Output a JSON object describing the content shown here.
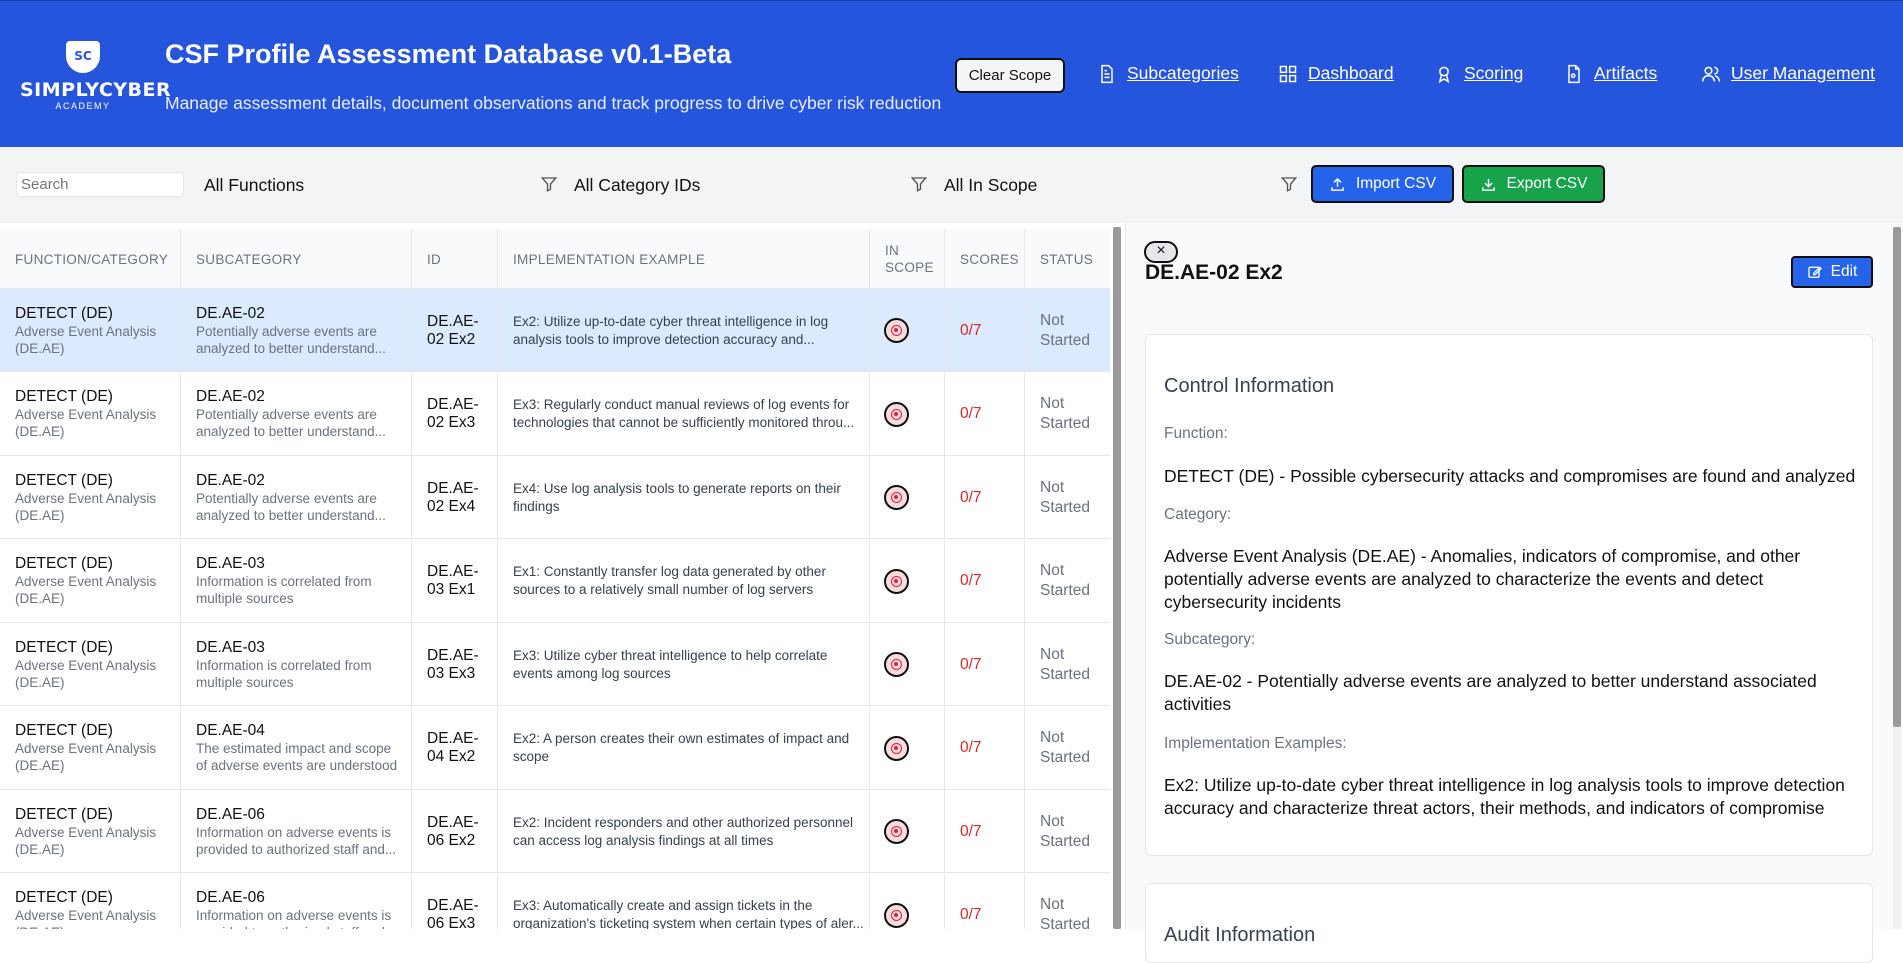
{
  "header": {
    "logo_name": "SIMPLYCYBER",
    "logo_sub": "ACADEMY",
    "logo_mark": "SC",
    "title": "CSF Profile Assessment Database v0.1-Beta",
    "subtitle": "Manage assessment details, document observations and track progress to drive cyber risk reduction",
    "clear_scope": "Clear Scope",
    "nav": {
      "subcategories": "Subcategories",
      "dashboard": "Dashboard",
      "scoring": "Scoring",
      "artifacts": "Artifacts",
      "users": "User Management"
    }
  },
  "toolbar": {
    "search_placeholder": "Search",
    "functions": "All Functions",
    "categories": "All Category IDs",
    "scope": "All In Scope",
    "import": "Import CSV",
    "export": "Export CSV"
  },
  "table": {
    "headers": {
      "func": "FUNCTION/CATEGORY",
      "sub": "SUBCATEGORY",
      "id": "ID",
      "ex": "IMPLEMENTATION EXAMPLE",
      "scope1": "IN",
      "scope2": "SCOPE",
      "scores": "SCORES",
      "status": "STATUS"
    },
    "rows": [
      {
        "func": "DETECT (DE)",
        "cat1": "Adverse Event Analysis",
        "cat2": "(DE.AE)",
        "sub": "DE.AE-02",
        "sub1": "Potentially adverse events are",
        "sub2": "analyzed to better understand...",
        "id1": "DE.AE-",
        "id2": "02 Ex2",
        "ex1": "Ex2: Utilize up-to-date cyber threat intelligence in log",
        "ex2": "analysis tools to improve detection accuracy and...",
        "score": "0/7",
        "st1": "Not",
        "st2": "Started"
      },
      {
        "func": "DETECT (DE)",
        "cat1": "Adverse Event Analysis",
        "cat2": "(DE.AE)",
        "sub": "DE.AE-02",
        "sub1": "Potentially adverse events are",
        "sub2": "analyzed to better understand...",
        "id1": "DE.AE-",
        "id2": "02 Ex3",
        "ex1": "Ex3: Regularly conduct manual reviews of log events for",
        "ex2": "technologies that cannot be sufficiently monitored throu...",
        "score": "0/7",
        "st1": "Not",
        "st2": "Started"
      },
      {
        "func": "DETECT (DE)",
        "cat1": "Adverse Event Analysis",
        "cat2": "(DE.AE)",
        "sub": "DE.AE-02",
        "sub1": "Potentially adverse events are",
        "sub2": "analyzed to better understand...",
        "id1": "DE.AE-",
        "id2": "02 Ex4",
        "ex1": "Ex4: Use log analysis tools to generate reports on their",
        "ex2": "findings",
        "score": "0/7",
        "st1": "Not",
        "st2": "Started"
      },
      {
        "func": "DETECT (DE)",
        "cat1": "Adverse Event Analysis",
        "cat2": "(DE.AE)",
        "sub": "DE.AE-03",
        "sub1": "Information is correlated from",
        "sub2": "multiple sources",
        "id1": "DE.AE-",
        "id2": "03 Ex1",
        "ex1": "Ex1: Constantly transfer log data generated by other",
        "ex2": "sources to a relatively small number of log servers",
        "score": "0/7",
        "st1": "Not",
        "st2": "Started"
      },
      {
        "func": "DETECT (DE)",
        "cat1": "Adverse Event Analysis",
        "cat2": "(DE.AE)",
        "sub": "DE.AE-03",
        "sub1": "Information is correlated from",
        "sub2": "multiple sources",
        "id1": "DE.AE-",
        "id2": "03 Ex3",
        "ex1": "Ex3: Utilize cyber threat intelligence to help correlate",
        "ex2": "events among log sources",
        "score": "0/7",
        "st1": "Not",
        "st2": "Started"
      },
      {
        "func": "DETECT (DE)",
        "cat1": "Adverse Event Analysis",
        "cat2": "(DE.AE)",
        "sub": "DE.AE-04",
        "sub1": "The estimated impact and scope",
        "sub2": "of adverse events are understood",
        "id1": "DE.AE-",
        "id2": "04 Ex2",
        "ex1": "Ex2: A person creates their own estimates of impact and",
        "ex2": "scope",
        "score": "0/7",
        "st1": "Not",
        "st2": "Started"
      },
      {
        "func": "DETECT (DE)",
        "cat1": "Adverse Event Analysis",
        "cat2": "(DE.AE)",
        "sub": "DE.AE-06",
        "sub1": "Information on adverse events is",
        "sub2": "provided to authorized staff and...",
        "id1": "DE.AE-",
        "id2": "06 Ex2",
        "ex1": "Ex2: Incident responders and other authorized personnel",
        "ex2": "can access log analysis findings at all times",
        "score": "0/7",
        "st1": "Not",
        "st2": "Started"
      },
      {
        "func": "DETECT (DE)",
        "cat1": "Adverse Event Analysis",
        "cat2": "(DE.AE)",
        "sub": "DE.AE-06",
        "sub1": "Information on adverse events is",
        "sub2": "provided to authorized staff and...",
        "id1": "DE.AE-",
        "id2": "06 Ex3",
        "ex1": "Ex3: Automatically create and assign tickets in the",
        "ex2": "organization's ticketing system when certain types of aler...",
        "score": "0/7",
        "st1": "Not",
        "st2": "Started"
      }
    ]
  },
  "detail": {
    "title": "DE.AE-02 Ex2",
    "edit": "Edit",
    "close": "×",
    "section": "Control Information",
    "function_label": "Function:",
    "function_value": "DETECT (DE) - Possible cybersecurity attacks and compromises are found and analyzed",
    "category_label": "Category:",
    "category_value": "Adverse Event Analysis (DE.AE) - Anomalies, indicators of compromise, and other potentially adverse events are analyzed to characterize the events and detect cybersecurity incidents",
    "subcategory_label": "Subcategory:",
    "subcategory_value": "DE.AE-02 - Potentially adverse events are analyzed to better understand associated activities",
    "impl_label": "Implementation Examples:",
    "impl_value": "Ex2: Utilize up-to-date cyber threat intelligence in log analysis tools to improve detection accuracy and characterize threat actors, their methods, and indicators of compromise",
    "section2": "Audit Information"
  },
  "colors": {
    "header_bg": "#2555dc",
    "import_btn": "#2563eb",
    "export_btn": "#16a34a",
    "score_red": "#dc2626",
    "selected_row": "#dbeafe"
  }
}
